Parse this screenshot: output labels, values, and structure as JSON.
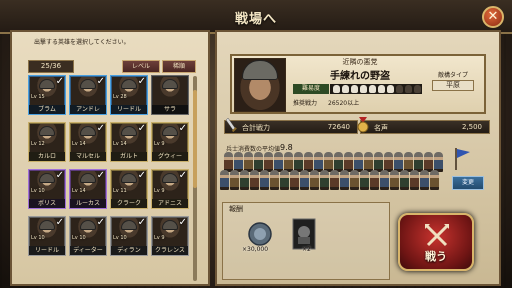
{
  "window": {
    "title": "戦場へ"
  },
  "roster": {
    "prompt": "出撃する英雄を選択してください。",
    "count": "25/36",
    "sort_level": "レベル",
    "sort_rarity": "稀順",
    "heroes": [
      {
        "name": "ブラム",
        "level": "Lv 15",
        "rarity": "blue",
        "selected": true
      },
      {
        "name": "アンドレ",
        "level": "",
        "rarity": "blue",
        "selected": true
      },
      {
        "name": "リードル",
        "level": "Lv 28",
        "rarity": "blue",
        "selected": true
      },
      {
        "name": "サラ",
        "level": "",
        "rarity": "dark",
        "selected": false
      },
      {
        "name": "カルロ",
        "level": "Lv 12",
        "rarity": "gold",
        "selected": false
      },
      {
        "name": "マルセル",
        "level": "Lv 14",
        "rarity": "gold",
        "selected": true
      },
      {
        "name": "ガルト",
        "level": "Lv 14",
        "rarity": "gold",
        "selected": true
      },
      {
        "name": "グウィー",
        "level": "Lv 9",
        "rarity": "gold",
        "selected": true
      },
      {
        "name": "ボリス",
        "level": "Lv 10",
        "rarity": "purple",
        "selected": true
      },
      {
        "name": "ルーカス",
        "level": "Lv 14",
        "rarity": "purple",
        "selected": true
      },
      {
        "name": "クラーク",
        "level": "Lv 11",
        "rarity": "gold",
        "selected": true
      },
      {
        "name": "アドニス",
        "level": "Lv 9",
        "rarity": "gold",
        "selected": true
      },
      {
        "name": "リードル",
        "level": "Lv 10",
        "rarity": "grey",
        "selected": true
      },
      {
        "name": "ディーター",
        "level": "Lv 10",
        "rarity": "grey",
        "selected": true
      },
      {
        "name": "ディラン",
        "level": "Lv 10",
        "rarity": "grey",
        "selected": true
      },
      {
        "name": "クラレンス",
        "level": "Lv 9",
        "rarity": "grey",
        "selected": true
      }
    ]
  },
  "enemy": {
    "subtitle": "近隣の悪党",
    "name": "手練れの野盗",
    "difficulty_label": "難易度",
    "difficulty_total": 10,
    "difficulty_filled": 7,
    "recommended_label": "推奨戦力",
    "recommended_value": "26520以上",
    "type_label": "敵構タイプ",
    "type_value": "平原"
  },
  "stats": {
    "power_label": "合計戦力",
    "power_value": "72640",
    "fame_label": "名声",
    "fame_value": "2,500"
  },
  "troops": {
    "label": "兵士消費数の平均値",
    "value": "9.8",
    "change_label": "変更"
  },
  "rewards": {
    "title": "報酬",
    "items": [
      {
        "icon": "silver-coin-icon",
        "qty": "×30,000"
      },
      {
        "icon": "hero-card-icon",
        "qty": "×2"
      }
    ]
  },
  "action": {
    "fight_label": "戦う"
  },
  "colors": {
    "accent_gold": "#d9b56a",
    "fight_red": "#c8332e",
    "panel_parchment": "#e4d7bb"
  }
}
